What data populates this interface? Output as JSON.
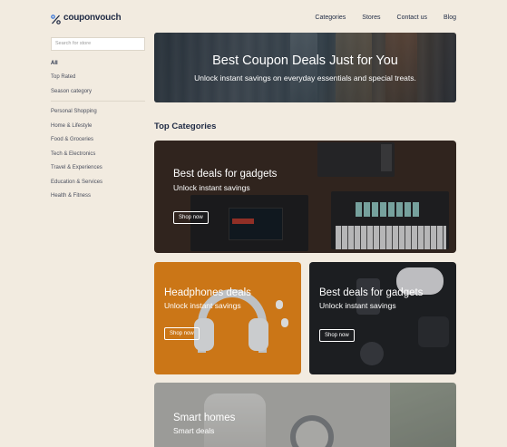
{
  "brand": {
    "name": "couponvouch",
    "accent": "#1f2a44"
  },
  "nav": {
    "categories": "Categories",
    "stores": "Stores",
    "contact": "Contact us",
    "blog": "Blog"
  },
  "sidebar": {
    "search_placeholder": "Search for store",
    "filters": [
      "All",
      "Top Rated",
      "Season category"
    ],
    "categories": [
      "Personal Shopping",
      "Home & Lifestyle",
      "Food & Groceries",
      "Tech & Electronics",
      "Travel & Experiences",
      "Education & Services",
      "Health & Fitness"
    ]
  },
  "hero": {
    "title": "Best Coupon Deals Just for You",
    "subtitle": "Unlock instant savings on everyday essentials and special treats."
  },
  "section": {
    "title": "Top Categories"
  },
  "cards": [
    {
      "title": "Best deals for gadgets",
      "subtitle": "Unlock instant savings",
      "button": "Shop now"
    },
    {
      "title": "Headphones deals",
      "subtitle": "Unlock instant savings",
      "button": "Shop now"
    },
    {
      "title": "Best deals for gadgets",
      "subtitle": "Unlock instant savings",
      "button": "Shop now"
    },
    {
      "title": "Smart homes",
      "subtitle": "Smart deals"
    }
  ]
}
